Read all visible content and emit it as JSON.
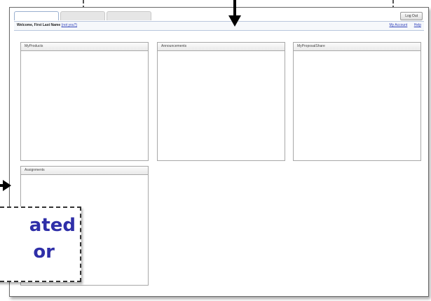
{
  "header": {
    "welcome_label": "Welcome, First Last Name",
    "logout_link": "(not you?)",
    "links": [
      "My Account",
      "Help"
    ],
    "logoff_label": "Log Out"
  },
  "tabs": [
    "",
    "",
    ""
  ],
  "panels": {
    "products": "MyProducts",
    "announcements": "Announcements",
    "proposals": "MyProposalShare",
    "assignments": "Assignments"
  },
  "callout": {
    "line1": "ated",
    "line2": "or"
  },
  "colors": {
    "callout_text": "#2f2fa8",
    "link": "#3344bb"
  }
}
